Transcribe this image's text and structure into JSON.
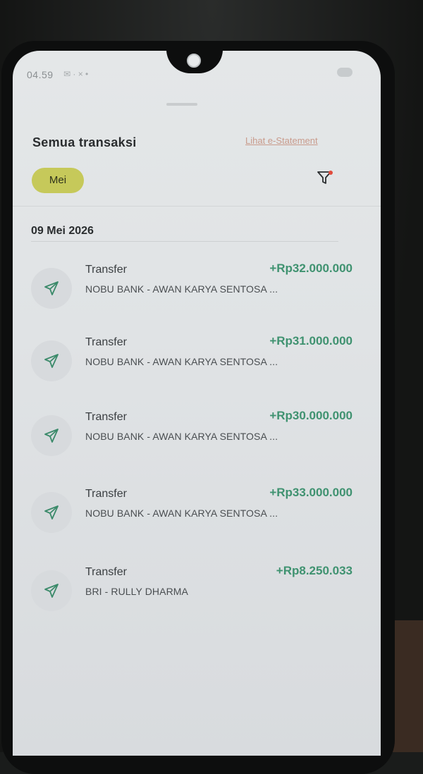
{
  "status_bar": {
    "time": "04.59"
  },
  "header": {
    "title": "Semua transaksi",
    "statement_link": "Lihat e-Statement"
  },
  "filter": {
    "month_chip": "Mei",
    "icon": "filter-icon"
  },
  "date_group": {
    "date": "09 Mei 2026"
  },
  "transactions": [
    {
      "type": "Transfer",
      "amount": "+Rp32.000.000",
      "description": "NOBU BANK - AWAN KARYA SENTOSA ...",
      "icon": "send-icon"
    },
    {
      "type": "Transfer",
      "amount": "+Rp31.000.000",
      "description": "NOBU BANK - AWAN KARYA SENTOSA ...",
      "icon": "send-icon"
    },
    {
      "type": "Transfer",
      "amount": "+Rp30.000.000",
      "description": "NOBU BANK - AWAN KARYA SENTOSA ...",
      "icon": "send-icon"
    },
    {
      "type": "Transfer",
      "amount": "+Rp33.000.000",
      "description": "NOBU BANK - AWAN KARYA SENTOSA ...",
      "icon": "send-icon"
    },
    {
      "type": "Transfer",
      "amount": "+Rp8.250.033",
      "description": "BRI - RULLY DHARMA",
      "icon": "send-icon"
    }
  ],
  "colors": {
    "accent_chip": "#c6c95a",
    "amount_positive": "#3f9270",
    "link": "#c99b8c",
    "icon_stroke": "#3b8a6a"
  }
}
